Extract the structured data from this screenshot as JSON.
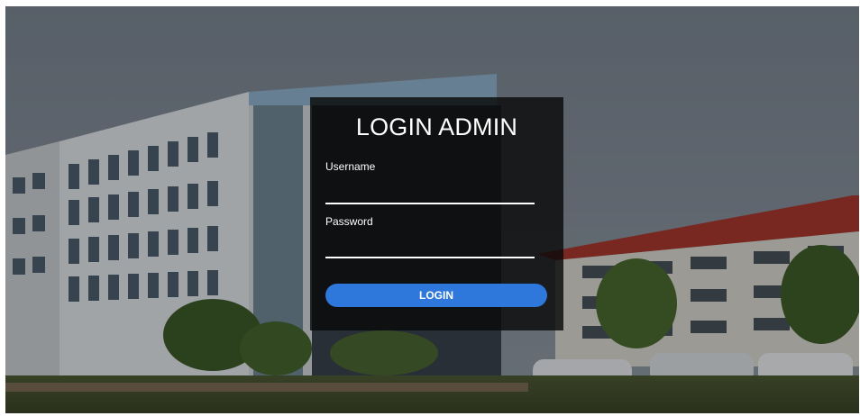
{
  "login": {
    "title": "LOGIN ADMIN",
    "username_label": "Username",
    "username_value": "",
    "password_label": "Password",
    "password_value": "",
    "button_label": "LOGIN"
  },
  "colors": {
    "panel_background": "#0a0a0a",
    "button": "#2f78db",
    "text": "#ffffff"
  }
}
